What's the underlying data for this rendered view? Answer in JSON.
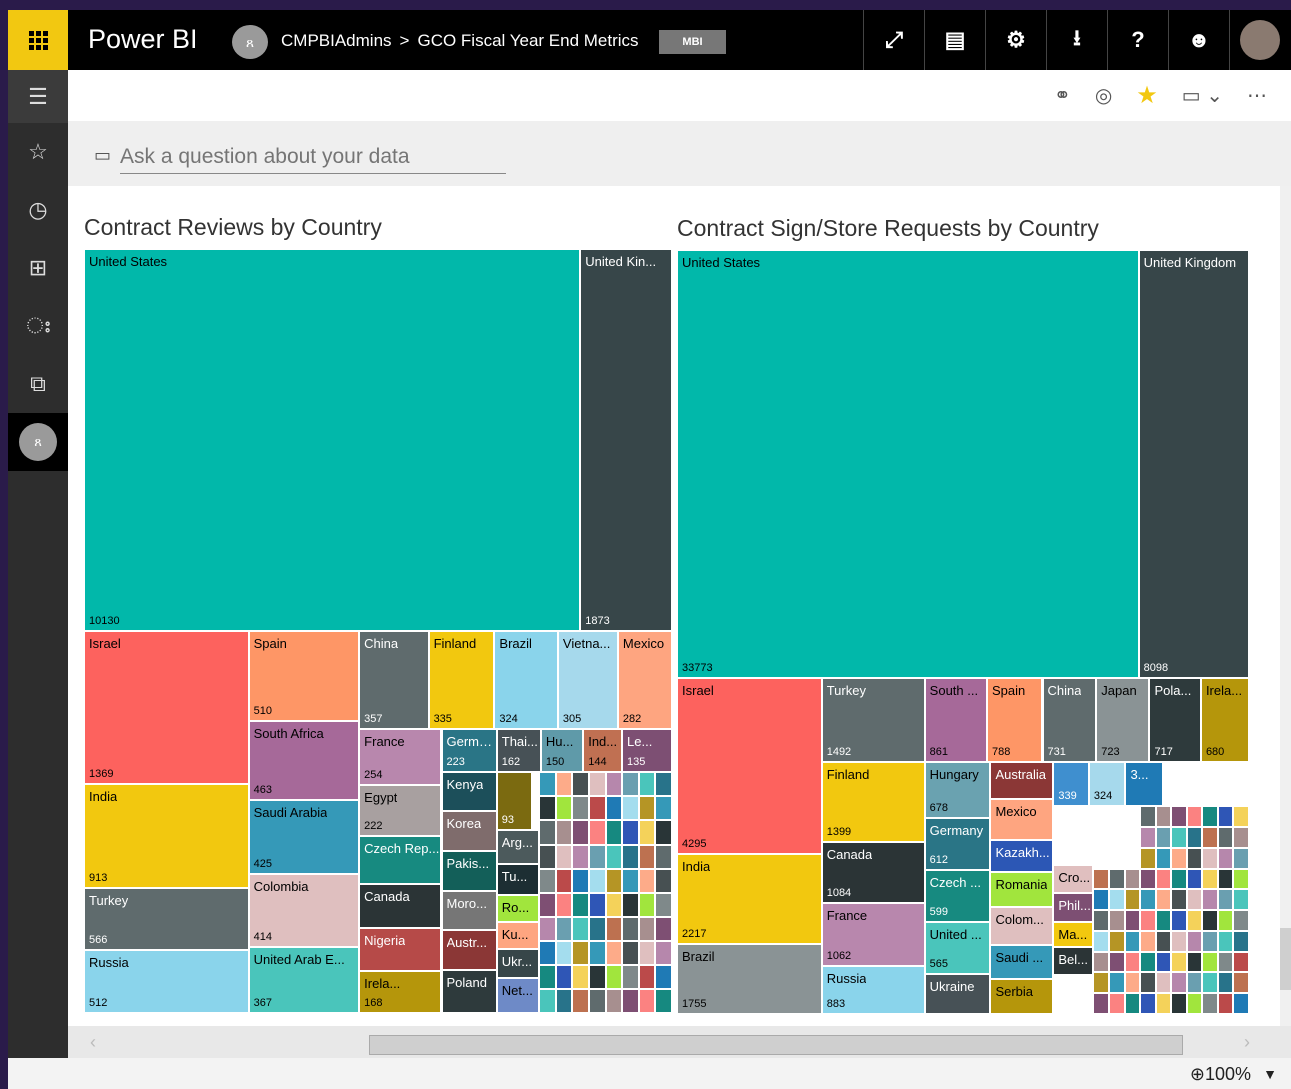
{
  "header": {
    "app_name": "Power BI",
    "workspace_icon": "group-icon",
    "workspace": "CMPBIAdmins",
    "breadcrumb_sep": ">",
    "page": "GCO Fiscal Year End Metrics",
    "badge": "MBI",
    "icons": [
      {
        "name": "expand-icon",
        "glyph": "⤢"
      },
      {
        "name": "feedback-icon",
        "glyph": "▤"
      },
      {
        "name": "settings-icon",
        "glyph": "⚙"
      },
      {
        "name": "download-icon",
        "glyph": "⭳"
      },
      {
        "name": "help-icon",
        "glyph": "?"
      },
      {
        "name": "smiley-icon",
        "glyph": "☻"
      }
    ]
  },
  "nav": [
    {
      "name": "hamburger-icon",
      "glyph": "☰"
    },
    {
      "name": "favorites-icon",
      "glyph": "☆"
    },
    {
      "name": "recent-icon",
      "glyph": "◷"
    },
    {
      "name": "apps-icon",
      "glyph": "⊞"
    },
    {
      "name": "shared-icon",
      "glyph": "ഃ"
    },
    {
      "name": "workspaces-icon",
      "glyph": "⧉"
    }
  ],
  "subbar": {
    "icons": [
      "link-icon",
      "performance-icon",
      "favorite-star-icon",
      "view-icon",
      "more-icon"
    ]
  },
  "qna": {
    "placeholder": "Ask a question about your data"
  },
  "status": {
    "zoom": "100%"
  },
  "colors": {
    "accent": "#f2c811"
  },
  "charts": [
    {
      "title": "Contract Reviews by Country",
      "tiles": [
        {
          "label": "United States",
          "value": "10130",
          "color": "#01b8aa"
        },
        {
          "label": "United Kin...",
          "value": "1873",
          "color": "#374649"
        },
        {
          "label": "Israel",
          "value": "1369",
          "color": "#fd625e"
        },
        {
          "label": "Spain",
          "value": "510",
          "color": "#fe9666"
        },
        {
          "label": "China",
          "value": "357",
          "color": "#5f6b6d"
        },
        {
          "label": "Finland",
          "value": "335",
          "color": "#f2c80f"
        },
        {
          "label": "Brazil",
          "value": "324",
          "color": "#8ad4eb"
        },
        {
          "label": "Vietna...",
          "value": "305",
          "color": "#a6d9ec"
        },
        {
          "label": "Mexico",
          "value": "282",
          "color": "#fea580"
        },
        {
          "label": "India",
          "value": "913",
          "color": "#f2c80f"
        },
        {
          "label": "Turkey",
          "value": "566",
          "color": "#5f6b6d"
        },
        {
          "label": "Russia",
          "value": "512",
          "color": "#8ad4eb"
        },
        {
          "label": "South Africa",
          "value": "463",
          "color": "#a66999"
        },
        {
          "label": "Saudi Arabia",
          "value": "425",
          "color": "#3599b8"
        },
        {
          "label": "Colombia",
          "value": "414",
          "color": "#dfbfbf"
        },
        {
          "label": "United Arab E...",
          "value": "367",
          "color": "#4ac5bb"
        },
        {
          "label": "France",
          "value": "254",
          "color": "#b887ad"
        },
        {
          "label": "Germany",
          "value": "223",
          "color": "#2a7586"
        },
        {
          "label": "Egypt",
          "value": "222",
          "color": "#a8a0a0"
        },
        {
          "label": "Czech Rep...",
          "value": "",
          "color": "#178a80"
        },
        {
          "label": "Canada",
          "value": "",
          "color": "#2b3436"
        },
        {
          "label": "Nigeria",
          "value": "",
          "color": "#b64a48"
        },
        {
          "label": "Irela...",
          "value": "168",
          "color": "#b5960b"
        },
        {
          "label": "Thai...",
          "value": "162",
          "color": "#475156"
        },
        {
          "label": "Hu...",
          "value": "150",
          "color": "#5f9aa9"
        },
        {
          "label": "Ind...",
          "value": "144",
          "color": "#c07052"
        },
        {
          "label": "Le...",
          "value": "135",
          "color": "#7d4f73"
        },
        {
          "label": "Kenya",
          "value": "",
          "color": "#1c4f5a"
        },
        {
          "label": "Korea",
          "value": "",
          "color": "#7f6c6c"
        },
        {
          "label": "Pakis...",
          "value": "",
          "color": "#135f59"
        },
        {
          "label": "Moro...",
          "value": "",
          "color": "#767676"
        },
        {
          "label": "Austr...",
          "value": "",
          "color": "#8b3736"
        },
        {
          "label": "Poland",
          "value": "",
          "color": "#2e3a3c"
        },
        {
          "label": "",
          "value": "93",
          "color": "#7b6a10"
        },
        {
          "label": "Arg...",
          "value": "",
          "color": "#4c5a5c"
        },
        {
          "label": "Tu...",
          "value": "",
          "color": "#1d2e33"
        },
        {
          "label": "Ro...",
          "value": "",
          "color": "#a1e53d"
        },
        {
          "label": "Ku...",
          "value": "",
          "color": "#fea580"
        },
        {
          "label": "Ukr...",
          "value": "",
          "color": "#374649"
        },
        {
          "label": "Net...",
          "value": "",
          "color": "#6e8ac7"
        }
      ]
    },
    {
      "title": "Contract Sign/Store Requests by Country",
      "tiles": [
        {
          "label": "United States",
          "value": "33773",
          "color": "#01b8aa"
        },
        {
          "label": "United Kingdom",
          "value": "8098",
          "color": "#374649"
        },
        {
          "label": "Israel",
          "value": "4295",
          "color": "#fd625e"
        },
        {
          "label": "India",
          "value": "2217",
          "color": "#f2c80f"
        },
        {
          "label": "Brazil",
          "value": "1755",
          "color": "#8a9395"
        },
        {
          "label": "Turkey",
          "value": "1492",
          "color": "#5f6b6d"
        },
        {
          "label": "Finland",
          "value": "1399",
          "color": "#f2c80f"
        },
        {
          "label": "Canada",
          "value": "1084",
          "color": "#2b3436"
        },
        {
          "label": "France",
          "value": "1062",
          "color": "#b887ad"
        },
        {
          "label": "Russia",
          "value": "883",
          "color": "#8ad4eb"
        },
        {
          "label": "South ...",
          "value": "861",
          "color": "#a66999"
        },
        {
          "label": "Spain",
          "value": "788",
          "color": "#fe9666"
        },
        {
          "label": "China",
          "value": "731",
          "color": "#5f6b6d"
        },
        {
          "label": "Japan",
          "value": "723",
          "color": "#8a9395"
        },
        {
          "label": "Pola...",
          "value": "717",
          "color": "#2e3a3c"
        },
        {
          "label": "Irela...",
          "value": "680",
          "color": "#b5960b"
        },
        {
          "label": "Hungary",
          "value": "678",
          "color": "#6aa2b0"
        },
        {
          "label": "Germany",
          "value": "612",
          "color": "#2a7586"
        },
        {
          "label": "Czech ...",
          "value": "599",
          "color": "#178a80"
        },
        {
          "label": "United ...",
          "value": "565",
          "color": "#4ac5bb"
        },
        {
          "label": "Ukraine",
          "value": "",
          "color": "#475156"
        },
        {
          "label": "Australia",
          "value": "",
          "color": "#8b3736"
        },
        {
          "label": "Mexico",
          "value": "",
          "color": "#fea580"
        },
        {
          "label": "Kazakh...",
          "value": "",
          "color": "#2c57b5"
        },
        {
          "label": "Romania",
          "value": "",
          "color": "#a1e53d"
        },
        {
          "label": "Colom...",
          "value": "",
          "color": "#dfbfbf"
        },
        {
          "label": "Saudi ...",
          "value": "",
          "color": "#3599b8"
        },
        {
          "label": "Serbia",
          "value": "",
          "color": "#b5960b"
        },
        {
          "label": "",
          "value": "339",
          "color": "#3f8fcf"
        },
        {
          "label": "",
          "value": "324",
          "color": "#a6d9ec"
        },
        {
          "label": "3...",
          "value": "",
          "color": "#1f7ab5"
        },
        {
          "label": "Cro...",
          "value": "",
          "color": "#e0bfbf"
        },
        {
          "label": "Phil...",
          "value": "",
          "color": "#7d4f73"
        },
        {
          "label": "Ma...",
          "value": "",
          "color": "#f2c80f"
        },
        {
          "label": "Bel...",
          "value": "",
          "color": "#2b3436"
        }
      ]
    }
  ]
}
